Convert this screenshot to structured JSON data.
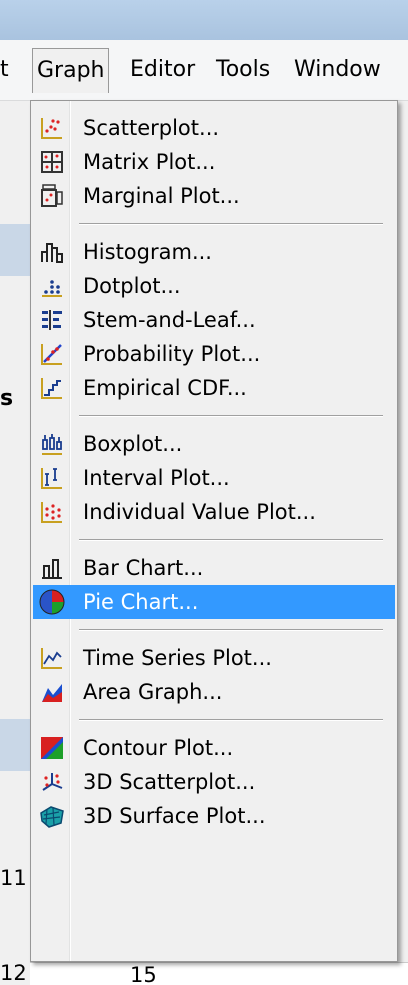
{
  "menubar": {
    "items": [
      {
        "label": "t"
      },
      {
        "label": "Graph"
      },
      {
        "label": "Editor"
      },
      {
        "label": "Tools"
      },
      {
        "label": "Window"
      }
    ]
  },
  "background": {
    "left_letter": "s",
    "bottom_left_numbers": [
      "11",
      "12"
    ],
    "bottom_cell": "15"
  },
  "graph_menu": {
    "groups": [
      [
        {
          "label": "Scatterplot...",
          "icon": "scatterplot-icon"
        },
        {
          "label": "Matrix Plot...",
          "icon": "matrix-plot-icon"
        },
        {
          "label": "Marginal Plot...",
          "icon": "marginal-plot-icon"
        }
      ],
      [
        {
          "label": "Histogram...",
          "icon": "histogram-icon"
        },
        {
          "label": "Dotplot...",
          "icon": "dotplot-icon"
        },
        {
          "label": "Stem-and-Leaf...",
          "icon": "stem-and-leaf-icon"
        },
        {
          "label": "Probability Plot...",
          "icon": "probability-plot-icon"
        },
        {
          "label": "Empirical CDF...",
          "icon": "empirical-cdf-icon"
        }
      ],
      [
        {
          "label": "Boxplot...",
          "icon": "boxplot-icon"
        },
        {
          "label": "Interval Plot...",
          "icon": "interval-plot-icon"
        },
        {
          "label": "Individual Value Plot...",
          "icon": "individual-value-plot-icon"
        }
      ],
      [
        {
          "label": "Bar Chart...",
          "icon": "bar-chart-icon"
        },
        {
          "label": "Pie Chart...",
          "icon": "pie-chart-icon",
          "selected": true
        }
      ],
      [
        {
          "label": "Time Series Plot...",
          "icon": "time-series-plot-icon"
        },
        {
          "label": "Area Graph...",
          "icon": "area-graph-icon"
        }
      ],
      [
        {
          "label": "Contour Plot...",
          "icon": "contour-plot-icon"
        },
        {
          "label": "3D Scatterplot...",
          "icon": "3d-scatterplot-icon"
        },
        {
          "label": "3D Surface Plot...",
          "icon": "3d-surface-plot-icon"
        }
      ]
    ]
  },
  "colors": {
    "selection": "#3399ff",
    "menu_bg": "#f0f0f0",
    "title_bg": "#b9d1ea"
  }
}
